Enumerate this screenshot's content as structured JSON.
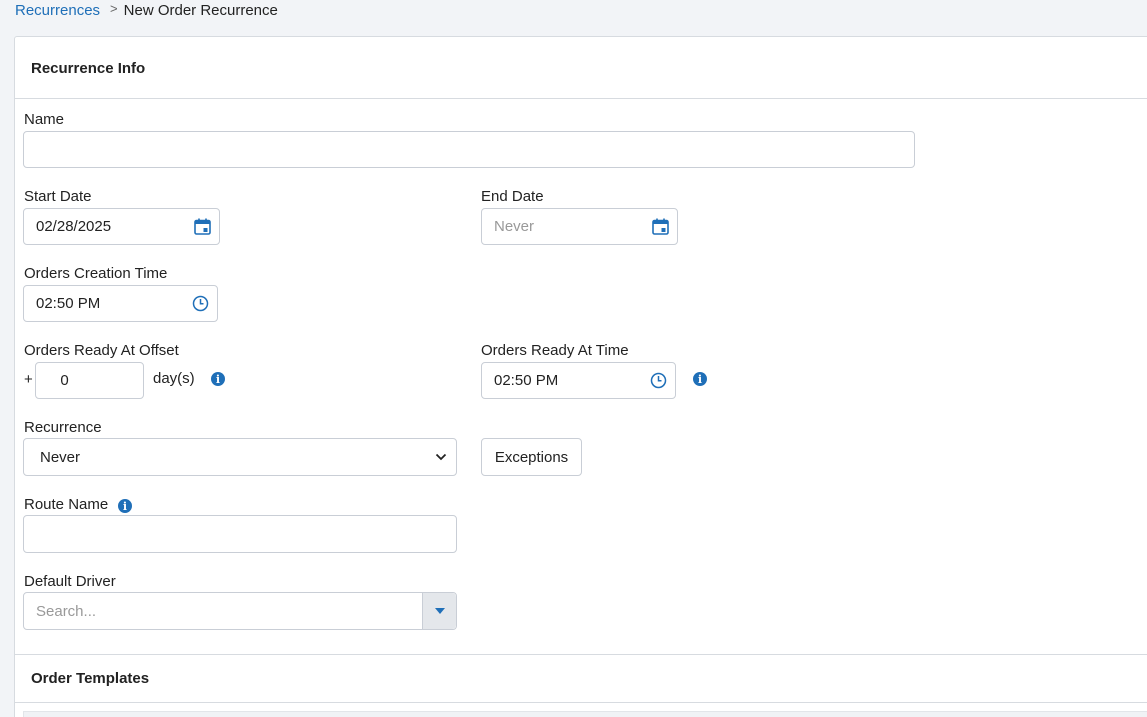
{
  "breadcrumb": {
    "parent": "Recurrences",
    "separator": ">",
    "current": "New Order Recurrence"
  },
  "sections": {
    "recurrence_info": "Recurrence Info",
    "order_templates": "Order Templates"
  },
  "form": {
    "name": {
      "label": "Name",
      "value": ""
    },
    "start_date": {
      "label": "Start Date",
      "value": "02/28/2025",
      "icon": "calendar-icon"
    },
    "end_date": {
      "label": "End Date",
      "placeholder": "Never",
      "icon": "calendar-icon"
    },
    "orders_creation_time": {
      "label": "Orders Creation Time",
      "value": "02:50 PM",
      "icon": "clock-icon"
    },
    "orders_ready_offset": {
      "label": "Orders Ready At Offset",
      "prefix": "+",
      "value": "0",
      "unit": "day(s)"
    },
    "orders_ready_time": {
      "label": "Orders Ready At Time",
      "value": "02:50 PM",
      "icon": "clock-icon"
    },
    "recurrence": {
      "label": "Recurrence",
      "selected": "Never"
    },
    "exceptions_button": "Exceptions",
    "route_name": {
      "label": "Route Name",
      "value": ""
    },
    "default_driver": {
      "label": "Default Driver",
      "placeholder": "Search..."
    }
  },
  "colors": {
    "accent": "#1f6fb8",
    "border": "#c9ced6",
    "background": "#f2f4f7"
  }
}
